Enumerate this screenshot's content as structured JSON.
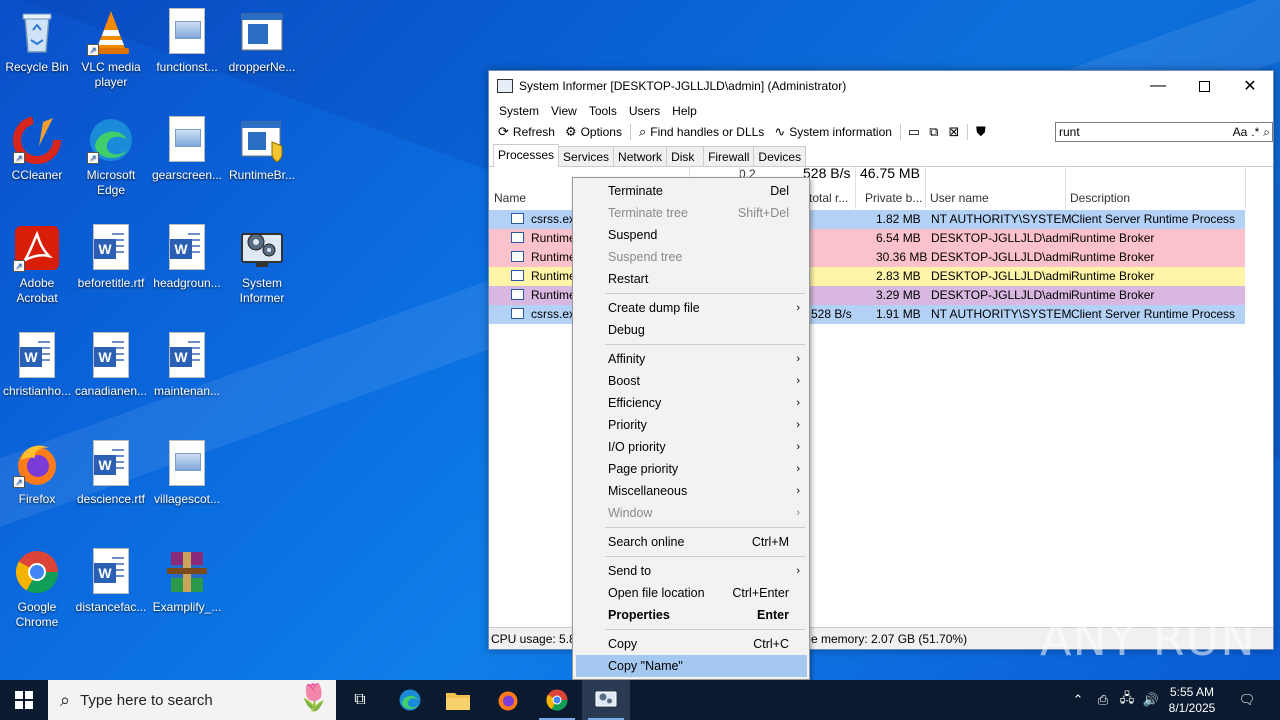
{
  "desktop": {
    "icons": [
      {
        "label": "Recycle Bin"
      },
      {
        "label": "VLC media player"
      },
      {
        "label": "functionst..."
      },
      {
        "label": "dropperNe..."
      },
      {
        "label": "CCleaner"
      },
      {
        "label": "Microsoft Edge"
      },
      {
        "label": "gearscreen..."
      },
      {
        "label": "RuntimeBr..."
      },
      {
        "label": "Adobe Acrobat"
      },
      {
        "label": "beforetitle.rtf"
      },
      {
        "label": "headgroun..."
      },
      {
        "label": "System Informer"
      },
      {
        "label": "christianho..."
      },
      {
        "label": "canadianen..."
      },
      {
        "label": "maintenan..."
      },
      {
        "label": "Firefox"
      },
      {
        "label": "descience.rtf"
      },
      {
        "label": "villagescot..."
      },
      {
        "label": "Google Chrome"
      },
      {
        "label": "distancefac..."
      },
      {
        "label": "Examplify_..."
      }
    ]
  },
  "window": {
    "title": "System Informer [DESKTOP-JGLLJLD\\admin] (Administrator)",
    "menu": [
      "System",
      "View",
      "Tools",
      "Users",
      "Help"
    ],
    "toolbar": {
      "refresh": "Refresh",
      "options": "Options",
      "find_handles": "Find handles or DLLs",
      "system_info": "System information",
      "search_value": "runt",
      "case_option": "Aa",
      "regex_option": ".*"
    },
    "tabs": [
      "Processes",
      "Services",
      "Network",
      "Disk",
      "Firewall",
      "Devices"
    ],
    "summary": {
      "cpu": "0.2",
      "io": "528 B/s",
      "private": "46.75 MB"
    },
    "columns": {
      "name": "Name",
      "io_total": "total r...",
      "private_bytes": "Private b...",
      "user_name": "User name",
      "description": "Description"
    },
    "rows": [
      {
        "name": "csrss.ex",
        "io": "",
        "private": "1.82 MB",
        "user": "NT AUTHORITY\\SYSTEM",
        "desc": "Client Server Runtime Process",
        "color": "#b3d1f5"
      },
      {
        "name": "Runtime",
        "io": "",
        "private": "6.54 MB",
        "user": "DESKTOP-JGLLJLD\\admi",
        "desc": "Runtime Broker",
        "color": "#fcc2cc"
      },
      {
        "name": "Runtime",
        "io": "",
        "private": "30.36 MB",
        "user": "DESKTOP-JGLLJLD\\admi",
        "desc": "Runtime Broker",
        "color": "#fcc2cc"
      },
      {
        "name": "Runtime",
        "io": "",
        "private": "2.83 MB",
        "user": "DESKTOP-JGLLJLD\\admi",
        "desc": "Runtime Broker",
        "color": "#fff5a8"
      },
      {
        "name": "Runtime",
        "io": "",
        "private": "3.29 MB",
        "user": "DESKTOP-JGLLJLD\\admi",
        "desc": "Runtime Broker",
        "color": "#d8b8e0"
      },
      {
        "name": "csrss.ex",
        "io": "528 B/s",
        "private": "1.91 MB",
        "user": "NT AUTHORITY\\SYSTEM",
        "desc": "Client Server Runtime Process",
        "color": "#b3d1f5"
      }
    ],
    "status": {
      "cpu": "CPU usage: 5.8",
      "memory": "e memory: 2.07 GB (51.70%)"
    }
  },
  "context_menu": {
    "items": [
      {
        "label": "Terminate",
        "shortcut": "Del"
      },
      {
        "label": "Terminate tree",
        "shortcut": "Shift+Del"
      },
      {
        "label": "Suspend",
        "shortcut": ""
      },
      {
        "label": "Suspend tree",
        "shortcut": ""
      },
      {
        "label": "Restart",
        "shortcut": ""
      },
      {
        "label": "Create dump file",
        "shortcut": ""
      },
      {
        "label": "Debug",
        "shortcut": ""
      },
      {
        "label": "Affinity",
        "shortcut": ""
      },
      {
        "label": "Boost",
        "shortcut": ""
      },
      {
        "label": "Efficiency",
        "shortcut": ""
      },
      {
        "label": "Priority",
        "shortcut": ""
      },
      {
        "label": "I/O priority",
        "shortcut": ""
      },
      {
        "label": "Page priority",
        "shortcut": ""
      },
      {
        "label": "Miscellaneous",
        "shortcut": ""
      },
      {
        "label": "Window",
        "shortcut": ""
      },
      {
        "label": "Search online",
        "shortcut": "Ctrl+M"
      },
      {
        "label": "Send to",
        "shortcut": ""
      },
      {
        "label": "Open file location",
        "shortcut": "Ctrl+Enter"
      },
      {
        "label": "Properties",
        "shortcut": "Enter"
      },
      {
        "label": "Copy",
        "shortcut": "Ctrl+C"
      },
      {
        "label": "Copy \"Name\"",
        "shortcut": ""
      }
    ]
  },
  "taskbar": {
    "search_placeholder": "Type here to search",
    "time": "5:55 AM",
    "date": "8/1/2025"
  },
  "watermark": "ANY RUN"
}
